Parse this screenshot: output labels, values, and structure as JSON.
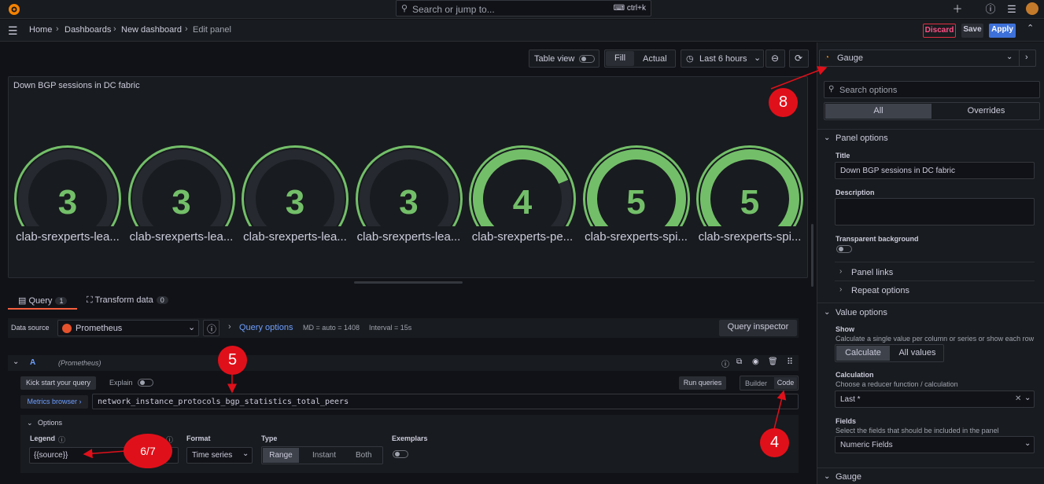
{
  "colors": {
    "accent": "#3d71d9",
    "green": "#73bf69",
    "discard": "#e02f44",
    "marker": "#e0101a",
    "orange": "#f58200"
  },
  "topbar": {
    "search_placeholder": "Search or jump to...",
    "shortcut": "ctrl+k",
    "logo_icon": "grafana-logo-icon"
  },
  "breadcrumbs": [
    "Home",
    "Dashboards",
    "New dashboard",
    "Edit panel"
  ],
  "actions": {
    "discard": "Discard",
    "save": "Save",
    "apply": "Apply"
  },
  "toolbar": {
    "table_view": "Table view",
    "fill": "Fill",
    "actual": "Actual",
    "time_range": "Last 6 hours"
  },
  "panel": {
    "title": "Down BGP sessions in DC fabric",
    "gauges": [
      {
        "value": "3",
        "label": "clab-srexperts-lea...",
        "fraction": 0.0
      },
      {
        "value": "3",
        "label": "clab-srexperts-lea...",
        "fraction": 0.0
      },
      {
        "value": "3",
        "label": "clab-srexperts-lea...",
        "fraction": 0.0
      },
      {
        "value": "3",
        "label": "clab-srexperts-lea...",
        "fraction": 0.0
      },
      {
        "value": "4",
        "label": "clab-srexperts-pe...",
        "fraction": 0.75
      },
      {
        "value": "5",
        "label": "clab-srexperts-spi...",
        "fraction": 1.0
      },
      {
        "value": "5",
        "label": "clab-srexperts-spi...",
        "fraction": 1.0
      }
    ]
  },
  "tabs": {
    "query": "Query",
    "query_count": "1",
    "transform": "Transform data",
    "transform_count": "0"
  },
  "datasource": {
    "label": "Data source",
    "name": "Prometheus",
    "query_options": "Query options",
    "md": "MD = auto = 1408",
    "interval": "Interval = 15s",
    "inspector": "Query inspector"
  },
  "query": {
    "ref": "A",
    "ds": "(Prometheus)",
    "kickstart": "Kick start your query",
    "explain": "Explain",
    "run": "Run queries",
    "builder": "Builder",
    "code": "Code",
    "metrics_browser": "Metrics browser",
    "expr": "network_instance_protocols_bgp_statistics_total_peers",
    "options": "Options",
    "legend_label": "Legend",
    "legend_value": "{{source}}",
    "format_label": "Format",
    "format_value": "Time series",
    "type_label": "Type",
    "type_range": "Range",
    "type_instant": "Instant",
    "type_both": "Both",
    "exemplars": "Exemplars"
  },
  "sidebar": {
    "viz": "Gauge",
    "search_placeholder": "Search options",
    "tab_all": "All",
    "tab_overrides": "Overrides",
    "panel_options": "Panel options",
    "title_label": "Title",
    "title_value": "Down BGP sessions in DC fabric",
    "description_label": "Description",
    "transparent_label": "Transparent background",
    "panel_links": "Panel links",
    "repeat_options": "Repeat options",
    "value_options": "Value options",
    "show_label": "Show",
    "show_desc": "Calculate a single value per column or series or show each row",
    "calculate": "Calculate",
    "all_values": "All values",
    "calc_label": "Calculation",
    "calc_desc": "Choose a reducer function / calculation",
    "calc_value": "Last *",
    "fields_label": "Fields",
    "fields_desc": "Select the fields that should be included in the panel",
    "fields_value": "Numeric Fields",
    "gauge_section": "Gauge"
  },
  "markers": [
    "8",
    "5",
    "4",
    "6/7"
  ]
}
